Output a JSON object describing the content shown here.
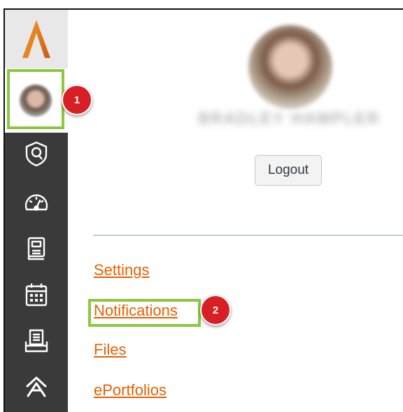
{
  "annotations": {
    "badge1": "1",
    "badge2": "2"
  },
  "account": {
    "user_name": "BRADLEY HAMPLER",
    "logout_label": "Logout"
  },
  "menu": {
    "links": [
      "Settings",
      "Notifications",
      "Files",
      "ePortfolios"
    ]
  },
  "sidebar": {
    "icons": [
      "logo-icon",
      "account-avatar",
      "admin-shield-icon",
      "dashboard-icon",
      "courses-icon",
      "calendar-icon",
      "inbox-icon",
      "commons-icon"
    ]
  },
  "colors": {
    "sidebar_bg": "#3a3a3a",
    "highlight": "#8dc63f",
    "badge": "#d91f26",
    "link": "#e66000",
    "logo_orange": "#e07a22"
  }
}
